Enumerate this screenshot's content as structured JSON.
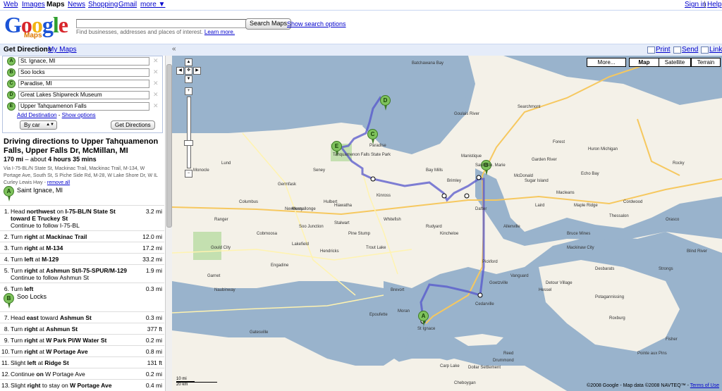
{
  "topbar": {
    "links": [
      "Web",
      "Images",
      "Maps",
      "News",
      "Shopping",
      "Gmail",
      "more ▼"
    ],
    "sign_in": "Sign in",
    "help": "Help"
  },
  "logo": {
    "maps": "Maps"
  },
  "search": {
    "value": "",
    "button": "Search Maps",
    "options": "Show search options",
    "hint": "Find businesses, addresses and places of interest.",
    "learn_more": "Learn more."
  },
  "toolbar": {
    "get_directions": "Get Directions",
    "my_maps": "My Maps",
    "collapse": "«",
    "print": "Print",
    "send": "Send",
    "link": "Link"
  },
  "destinations": [
    {
      "letter": "A",
      "value": "St. Ignace, MI"
    },
    {
      "letter": "B",
      "value": "Soo locks"
    },
    {
      "letter": "C",
      "value": "Paradise, MI"
    },
    {
      "letter": "D",
      "value": "Great Lakes Shipwreck Museum"
    },
    {
      "letter": "E",
      "value": "Upper Tahquamenon Falls"
    }
  ],
  "dest_links": {
    "add": "Add Destination",
    "dash": "-",
    "options": "Show options"
  },
  "mode": "By car",
  "get_directions_button": "Get Directions",
  "directions": {
    "title": "Driving directions to Upper Tahquamenon Falls, Upper Falls Dr, McMillan, MI",
    "distance": "170 mi",
    "about": "– about",
    "time": "4 hours 35 mins",
    "via": "Via I-75-BL/N State St, Mackinac Trail, Mackinac Trail, M-134, W Portage Ave, South St, S Piche Side Rd, M-28, W Lake Shore Dr, W IL Curley Lewis Hwy -",
    "remove_all": "remove all",
    "start": "Saint Ignace, MI",
    "soo": "Soo Locks",
    "steps_a": [
      {
        "n": "1.",
        "t": "Head northwest on I-75-BL/N State St toward E Truckey St",
        "sub": "Continue to follow I-75-BL",
        "d": "3.2 mi"
      },
      {
        "n": "2.",
        "t": "Turn right at Mackinac Trail",
        "d": "12.0 mi"
      },
      {
        "n": "3.",
        "t": "Turn right at M-134",
        "d": "17.2 mi"
      },
      {
        "n": "4.",
        "t": "Turn left at M-129",
        "d": "33.2 mi"
      },
      {
        "n": "5.",
        "t": "Turn right at Ashmun St/I-75-SPUR/M-129",
        "sub": "Continue to follow Ashmun St",
        "d": "1.9 mi"
      },
      {
        "n": "6.",
        "t": "Turn left",
        "d": "0.3 mi"
      }
    ],
    "steps_b": [
      {
        "n": "7.",
        "t": "Head east toward Ashmun St",
        "d": "0.3 mi"
      },
      {
        "n": "8.",
        "t": "Turn right at Ashmun St",
        "d": "377 ft"
      },
      {
        "n": "9.",
        "t": "Turn right at W Park Pl/W Water St",
        "d": "0.2 mi"
      },
      {
        "n": "10.",
        "t": "Turn right at W Portage Ave",
        "d": "0.8 mi"
      },
      {
        "n": "11.",
        "t": "Slight left at Ridge St",
        "d": "131 ft"
      },
      {
        "n": "12.",
        "t": "Continue on W Portage Ave",
        "d": "0.2 mi"
      },
      {
        "n": "13.",
        "t": "Slight right to stay on W Portage Ave",
        "d": "0.4 mi"
      }
    ]
  },
  "map": {
    "more": "More...",
    "types": [
      "Map",
      "Satellite",
      "Terrain"
    ],
    "labels": [
      "Batchawana Bay",
      "Goulais River",
      "Searchmont",
      "Sault Ste. Marie",
      "Newberry",
      "Columbus",
      "Hulbert",
      "Kinross",
      "Paradise",
      "Tahquamenon Falls State Park",
      "Rudyard",
      "Pickford",
      "Cedarville",
      "St Ignace",
      "Cheboygan",
      "Carp Lake",
      "Trout Lake",
      "Engadine",
      "Naubinway",
      "Brevort",
      "Drummond",
      "Hessel",
      "Detour Village",
      "Desbarats",
      "Thessalon",
      "Blind River",
      "Garden River",
      "Echo Bay",
      "Laird",
      "Bruce Mines",
      "Kincheloe",
      "Goetzville",
      "Epoufette",
      "Moran",
      "Garnet",
      "Gould City",
      "Hendricks",
      "Allenville",
      "Dafter",
      "Bay Mills",
      "Brimley",
      "McDonald",
      "Macleans",
      "Sugar Island",
      "Maple Ridge",
      "Cordwood",
      "Potagannissing",
      "Pointe aux Pins",
      "Vanguard",
      "Roxburg",
      "Strongs",
      "Rocky",
      "Lund",
      "Monocle",
      "Ranger",
      "Cobmoosa",
      "Lakefield",
      "Reed",
      "Mackinaw City",
      "Dollar Settlement",
      "Fisher",
      "Orasco",
      "Gatesville",
      "Forest",
      "Huron Michigan",
      "Manistique",
      "Seney",
      "Germfask",
      "Whitefish",
      "Pine Stump",
      "Soo Junction",
      "Hiawatha",
      "Muscallonge",
      "Stalwart"
    ],
    "copyright": "©2008 Google - Map data ©2008 NAVTEQ™ -",
    "terms": "Terms of Use",
    "scale_mi": "10 mi",
    "scale_km": "20 km",
    "route_markers": [
      "A",
      "B",
      "C",
      "D",
      "E"
    ]
  }
}
